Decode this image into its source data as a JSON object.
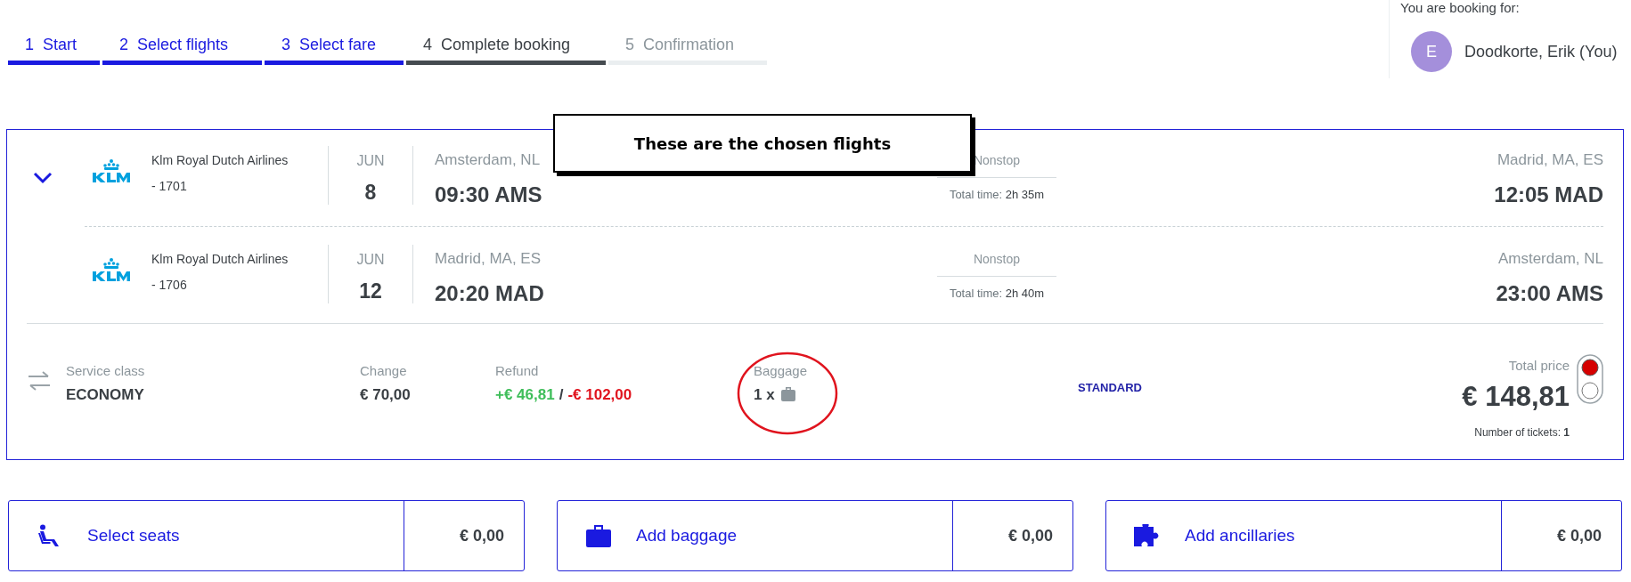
{
  "steps": [
    {
      "number": "1",
      "label": "Start",
      "completed": true,
      "selected": false
    },
    {
      "number": "2",
      "label": "Select flights",
      "completed": true,
      "selected": false
    },
    {
      "number": "3",
      "label": "Select fare",
      "completed": true,
      "selected": false
    },
    {
      "number": "4",
      "label": "Complete booking",
      "completed": false,
      "selected": true
    },
    {
      "number": "5",
      "label": "Confirmation",
      "completed": false,
      "selected": false
    }
  ],
  "booking_for": {
    "label": "You are booking for:",
    "initial": "E",
    "name": "Doodkorte, Erik (You)"
  },
  "callout": "These are the chosen flights",
  "itinerary": {
    "expanded": true,
    "flights": [
      {
        "airline": "Klm Royal Dutch Airlines",
        "flight_number": "- 1701",
        "month": "JUN",
        "day": "8",
        "from_city": "Amsterdam, NL",
        "departure": "09:30 AMS",
        "stops": "Nonstop",
        "total_time_label": "Total time:",
        "total_time": "2h 35m",
        "to_city": "Madrid, MA, ES",
        "arrival": "12:05 MAD"
      },
      {
        "airline": "Klm Royal Dutch Airlines",
        "flight_number": "- 1706",
        "month": "JUN",
        "day": "12",
        "from_city": "Madrid, MA, ES",
        "departure": "20:20 MAD",
        "stops": "Nonstop",
        "total_time_label": "Total time:",
        "total_time": "2h 40m",
        "to_city": "Amsterdam, NL",
        "arrival": "23:00 AMS"
      }
    ],
    "summary": {
      "service_class_label": "Service class",
      "service_class": "ECONOMY",
      "change_label": "Change",
      "change": "€ 70,00",
      "refund_label": "Refund",
      "refund_gain": "+€ 46,81",
      "refund_separator": "/",
      "refund_loss": "-€ 102,00",
      "baggage_label": "Baggage",
      "baggage": "1 x",
      "fare": "STANDARD",
      "total_label": "Total price",
      "total": "€ 148,81",
      "tickets_label": "Number of tickets:",
      "tickets": "1"
    }
  },
  "extras": [
    {
      "kind": "seat",
      "label": "Select seats",
      "price": "€ 0,00"
    },
    {
      "kind": "baggage",
      "label": "Add baggage",
      "price": "€ 0,00"
    },
    {
      "kind": "ancillary",
      "label": "Add ancillaries",
      "price": "€ 0,00"
    }
  ]
}
